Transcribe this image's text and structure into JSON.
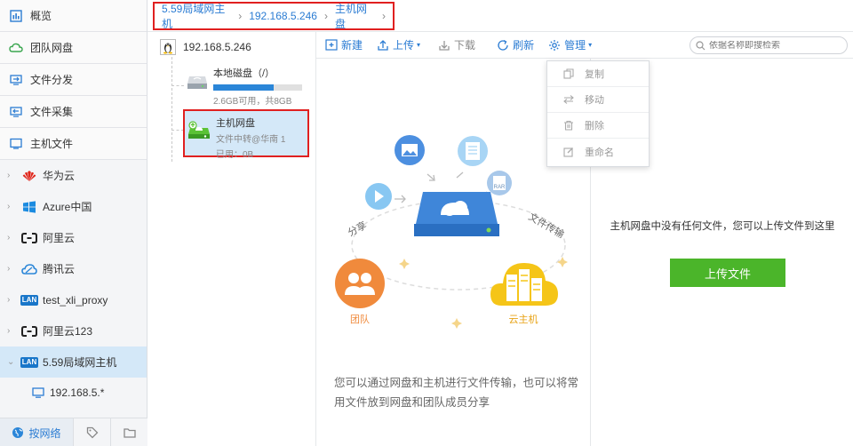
{
  "sidebar": {
    "nav": [
      {
        "label": "概览",
        "icon": "overview-icon"
      },
      {
        "label": "团队网盘",
        "icon": "team-cloud-icon"
      },
      {
        "label": "文件分发",
        "icon": "distribute-icon"
      },
      {
        "label": "文件采集",
        "icon": "collect-icon"
      },
      {
        "label": "主机文件",
        "icon": "host-file-icon"
      }
    ],
    "clouds": [
      {
        "label": "华为云",
        "icon": "huawei-icon"
      },
      {
        "label": "Azure中国",
        "icon": "azure-icon"
      },
      {
        "label": "阿里云",
        "icon": "aliyun-icon"
      },
      {
        "label": "腾讯云",
        "icon": "tencent-icon"
      },
      {
        "label": "test_xli_proxy",
        "icon": "lan-icon",
        "badge": "LAN"
      },
      {
        "label": "阿里云123",
        "icon": "aliyun-icon"
      },
      {
        "label": "5.59局域网主机",
        "icon": "lan-icon",
        "badge": "LAN"
      }
    ],
    "sub_host": "192.168.5.*",
    "bottom": {
      "network_label": "按网络"
    }
  },
  "breadcrumb": [
    "5.59局域网主机",
    "192.168.5.246",
    "主机网盘"
  ],
  "host": {
    "ip": "192.168.5.246",
    "local_disk": {
      "title": "本地磁盘（/）",
      "usage": "2.6GB可用，共8GB",
      "used_fraction": 0.68
    },
    "host_disk": {
      "title": "主机网盘",
      "relay": "文件中转@华南 1",
      "used": "已用：0B"
    }
  },
  "toolbar": {
    "new": "新建",
    "upload": "上传",
    "download": "下载",
    "refresh": "刷新",
    "manage": "管理",
    "search_placeholder": "依据名称即搜检索"
  },
  "manage_menu": [
    "复制",
    "移动",
    "删除",
    "重命名"
  ],
  "illustration": {
    "share": "分享",
    "transfer": "文件传输",
    "team": "团队",
    "host": "云主机",
    "rar": "RAR",
    "caption": "您可以通过网盘和主机进行文件传输，也可以将常用文件放到网盘和团队成员分享"
  },
  "empty": {
    "message": "主机网盘中没有任何文件，您可以上传文件到这里",
    "upload_button": "上传文件"
  },
  "colors": {
    "accent": "#2b7cd3",
    "upload_green": "#4bb52a",
    "highlight_red": "#e02020",
    "team_orange": "#f08a3c",
    "host_yellow": "#f5c518"
  }
}
